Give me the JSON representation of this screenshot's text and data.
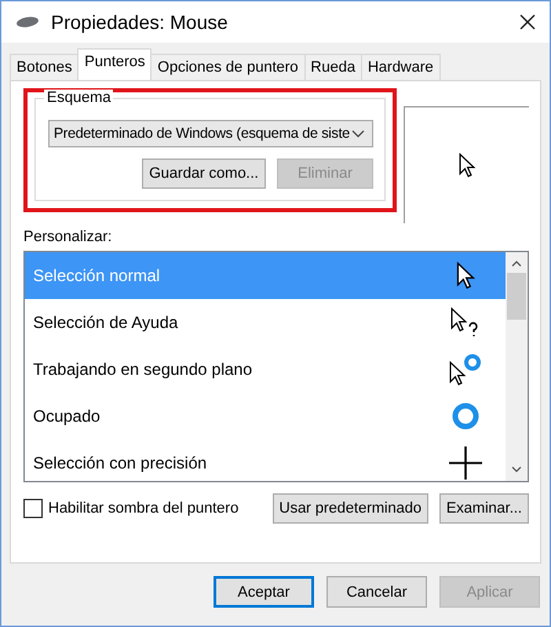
{
  "window": {
    "title": "Propiedades: Mouse"
  },
  "tabs": [
    {
      "label": "Botones",
      "selected": false
    },
    {
      "label": "Punteros",
      "selected": true
    },
    {
      "label": "Opciones de puntero",
      "selected": false
    },
    {
      "label": "Rueda",
      "selected": false
    },
    {
      "label": "Hardware",
      "selected": false
    }
  ],
  "scheme": {
    "label": "Esquema",
    "value": "Predeterminado de Windows (esquema de siste",
    "buttons": [
      {
        "label": "Guardar como...",
        "disabled": false
      },
      {
        "label": "Eliminar",
        "disabled": true
      }
    ]
  },
  "customize": {
    "label": "Personalizar:",
    "items": [
      {
        "label": "Selección normal",
        "kind": "arrow",
        "selected": true
      },
      {
        "label": "Selección de Ayuda",
        "kind": "help",
        "selected": false
      },
      {
        "label": "Trabajando en segundo plano",
        "kind": "working",
        "selected": false
      },
      {
        "label": "Ocupado",
        "kind": "busy",
        "selected": false
      },
      {
        "label": "Selección con precisión",
        "kind": "precision",
        "selected": false
      }
    ]
  },
  "shadow": {
    "label": "Habilitar sombra del puntero",
    "checked": false
  },
  "side_buttons": [
    {
      "label": "Usar predeterminado",
      "disabled": false
    },
    {
      "label": "Examinar...",
      "disabled": false
    }
  ],
  "footer_buttons": [
    {
      "label": "Aceptar",
      "disabled": false,
      "default": true
    },
    {
      "label": "Cancelar",
      "disabled": false,
      "default": false
    },
    {
      "label": "Aplicar",
      "disabled": true,
      "default": false
    }
  ]
}
